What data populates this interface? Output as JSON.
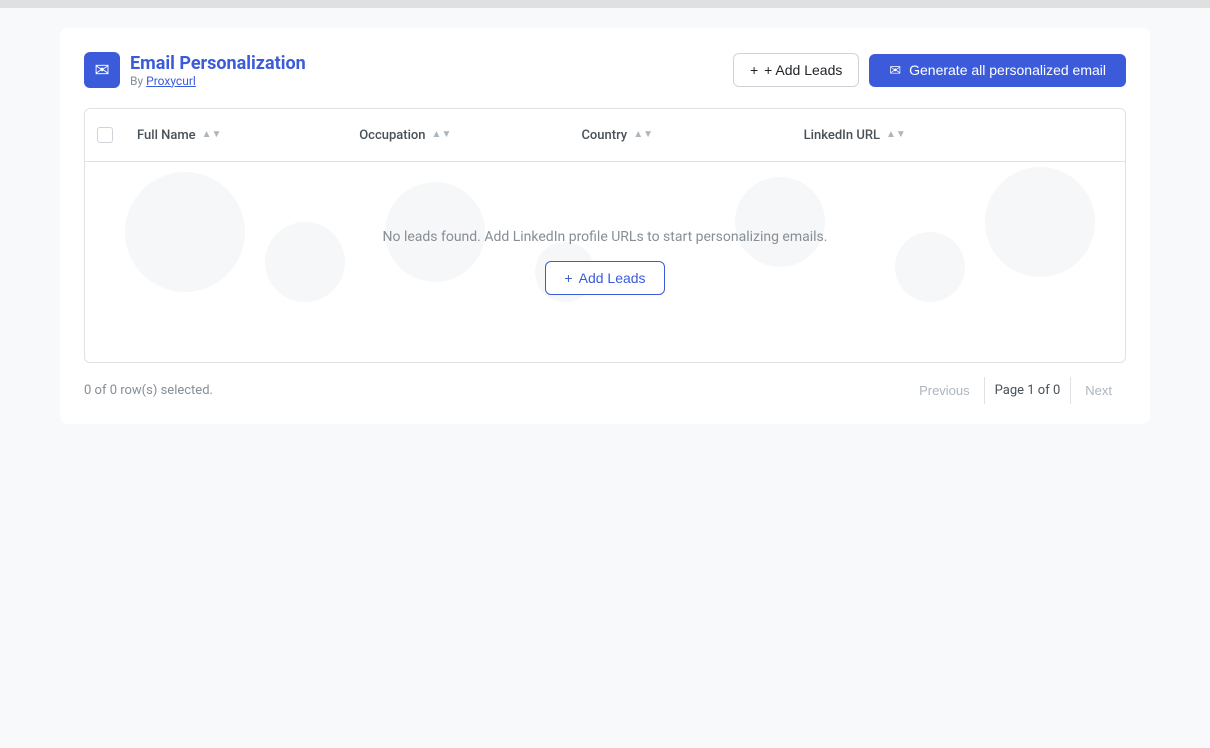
{
  "topbar": {},
  "header": {
    "app_icon": "✉",
    "app_title": "Email Personalization",
    "subtitle_prefix": "By",
    "subtitle_link_text": "Proxycurl",
    "add_leads_label": "+ Add Leads",
    "generate_label": "Generate all personalized email",
    "generate_icon": "✉"
  },
  "table": {
    "columns": [
      {
        "id": "checkbox",
        "label": ""
      },
      {
        "id": "full_name",
        "label": "Full Name"
      },
      {
        "id": "occupation",
        "label": "Occupation"
      },
      {
        "id": "country",
        "label": "Country"
      },
      {
        "id": "linkedin_url",
        "label": "LinkedIn URL"
      }
    ],
    "empty_message": "No leads found. Add LinkedIn profile URLs to start personalizing emails.",
    "add_leads_empty_label": "+ Add Leads"
  },
  "footer": {
    "rows_selected": "0 of 0 row(s) selected.",
    "previous_label": "Previous",
    "page_info": "Page 1 of 0",
    "next_label": "Next"
  }
}
